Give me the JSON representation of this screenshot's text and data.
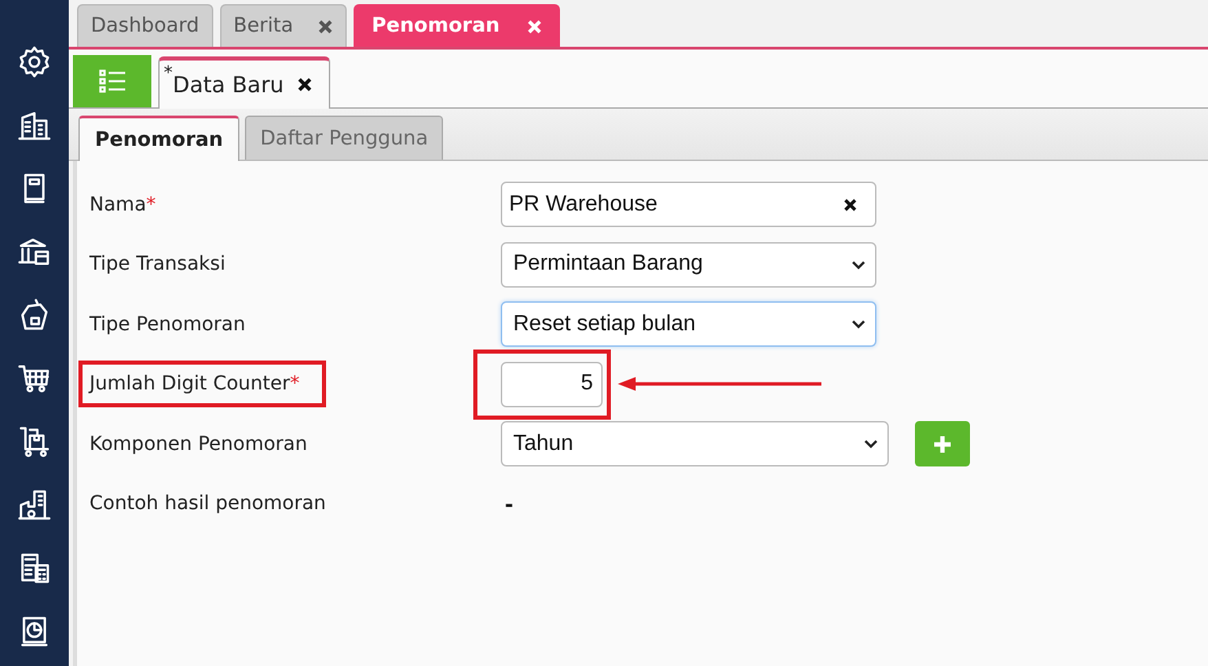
{
  "top_tabs": [
    {
      "label": "Dashboard",
      "selected": false,
      "closable": false
    },
    {
      "label": "Berita",
      "selected": false,
      "closable": true
    },
    {
      "label": "Penomoran",
      "selected": true,
      "closable": true
    }
  ],
  "doc_tab": {
    "modified_mark": "*",
    "label": "Data Baru",
    "closable": true
  },
  "inner_tabs": [
    {
      "label": "Penomoran",
      "selected": true
    },
    {
      "label": "Daftar Pengguna",
      "selected": false
    }
  ],
  "fields": [
    {
      "kind": "text",
      "label": "Nama",
      "required_mark": "*",
      "value": "PR Warehouse",
      "clearable": true,
      "highlighted": false
    },
    {
      "kind": "select",
      "label": "Tipe Transaksi",
      "value": "Permintaan Barang",
      "focused": false,
      "highlighted": false
    },
    {
      "kind": "select",
      "label": "Tipe Penomoran",
      "value": "Reset setiap bulan",
      "focused": true,
      "highlighted": false
    },
    {
      "kind": "number",
      "label": "Jumlah Digit Counter",
      "required_mark": "*",
      "value": "5",
      "highlighted": true
    },
    {
      "kind": "select",
      "label": "Komponen Penomoran",
      "value": "Tahun",
      "focused": false,
      "add_button": true,
      "highlighted": false
    },
    {
      "kind": "static",
      "label": "Contoh hasil penomoran",
      "value": "-",
      "highlighted": false
    }
  ]
}
